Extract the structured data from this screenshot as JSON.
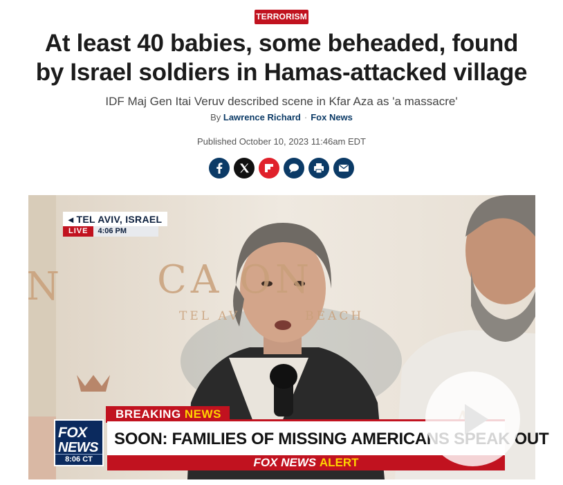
{
  "article": {
    "category": "TERRORISM",
    "headline_line1": "At least 40 babies, some beheaded, found",
    "headline_line2": "by Israel soldiers in Hamas-attacked village",
    "subheadline": "IDF Maj Gen Itai Veruv described scene in Kfar Aza as 'a massacre'",
    "byline_prefix": "By",
    "author": "Lawrence Richard",
    "separator": "·",
    "source": "Fox News",
    "published": "Published October 10, 2023 11:46am EDT"
  },
  "share": {
    "icons": [
      "facebook-icon",
      "x-icon",
      "flipboard-icon",
      "comments-icon",
      "print-icon",
      "email-icon"
    ],
    "colors": {
      "dark_blue": "#0b3a66",
      "black": "#111111",
      "red": "#e0212b"
    }
  },
  "video": {
    "location": "TEL AVIV, ISRAEL",
    "live_label": "LIVE",
    "live_time": "4:06 PM",
    "wall_text_big": "CA      ON",
    "wall_text_small": "TEL AV          BEACH",
    "breaking_label": "BREAKING",
    "breaking_label2": "NEWS",
    "chyron": "SOON: FAMILIES OF MISSING AMERICANS SPEAK OUT",
    "alert_prefix": "FOX NEWS",
    "alert_word": "ALERT",
    "logo_line1": "FOX",
    "logo_line2": "NEWS",
    "logo_time": "8:06 CT",
    "play_icon": "play-icon"
  }
}
